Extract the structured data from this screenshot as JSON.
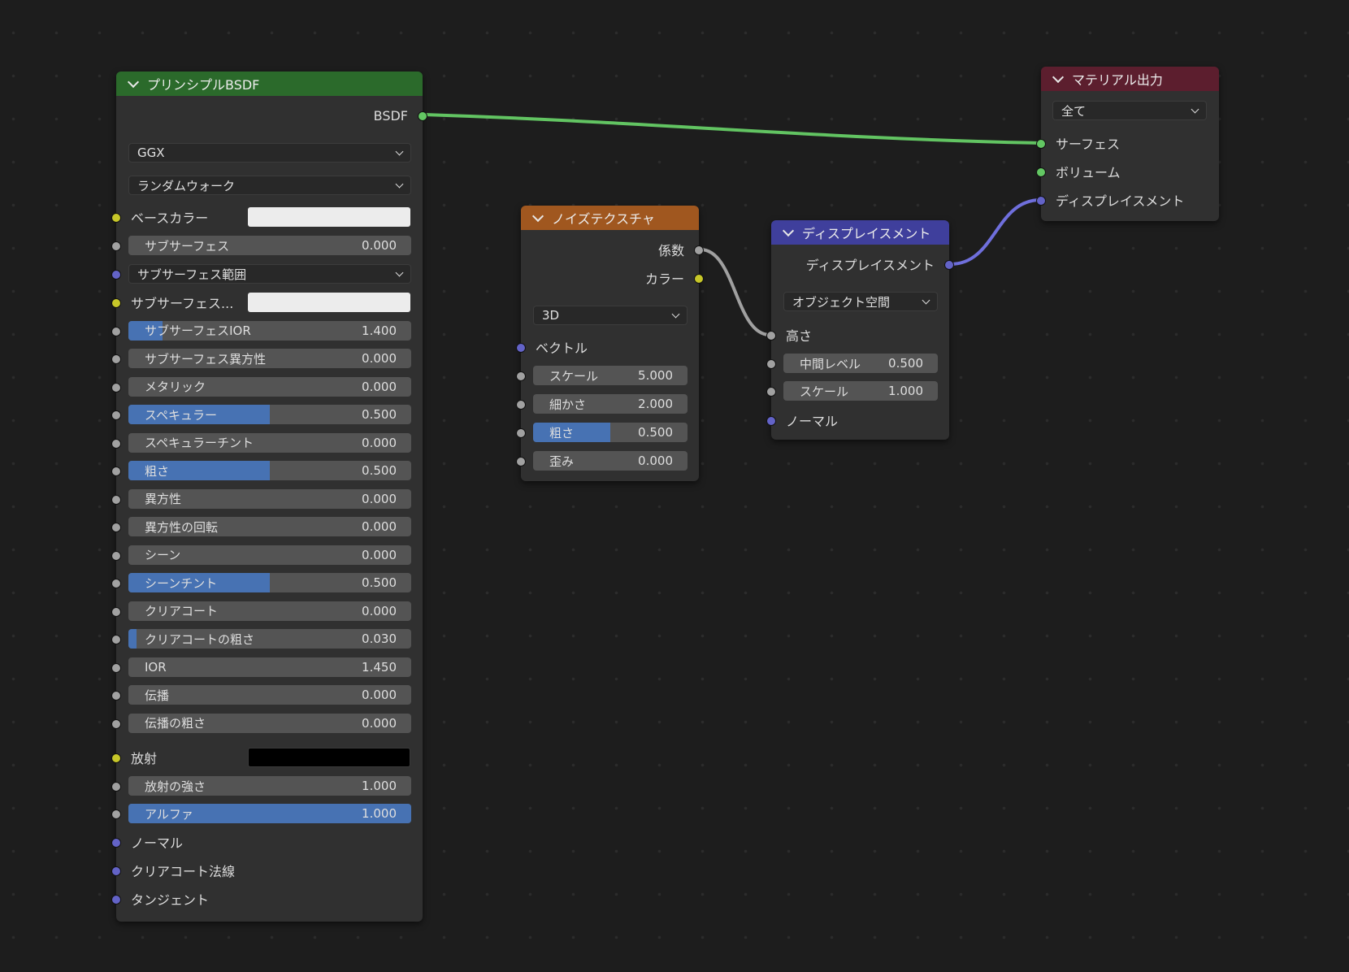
{
  "colors": {
    "link_bsdf": "#62c462",
    "link_gray": "#a0a0a0",
    "link_vector": "#6f6fdc",
    "header_shader": "#2b6a2b",
    "header_texture": "#a0571f",
    "header_vector": "#3f3f9c",
    "header_output": "#5c1e2e"
  },
  "bsdf": {
    "title": "プリンシプルBSDF",
    "output": "BSDF",
    "distribution": "GGX",
    "subsurface_method": "ランダムウォーク",
    "base_color_label": "ベースカラー",
    "subsurface_radius": "サブサーフェス範囲",
    "subsurface_color_label": "サブサーフェス...",
    "emission_label": "放射",
    "params": [
      {
        "label": "サブサーフェス",
        "value": "0.000",
        "fill": 0
      },
      {
        "label": "サブサーフェスIOR",
        "value": "1.400",
        "fill": 0.12
      },
      {
        "label": "サブサーフェス異方性",
        "value": "0.000",
        "fill": 0
      },
      {
        "label": "メタリック",
        "value": "0.000",
        "fill": 0
      },
      {
        "label": "スペキュラー",
        "value": "0.500",
        "fill": 0.5
      },
      {
        "label": "スペキュラーチント",
        "value": "0.000",
        "fill": 0
      },
      {
        "label": "粗さ",
        "value": "0.500",
        "fill": 0.5
      },
      {
        "label": "異方性",
        "value": "0.000",
        "fill": 0
      },
      {
        "label": "異方性の回転",
        "value": "0.000",
        "fill": 0
      },
      {
        "label": "シーン",
        "value": "0.000",
        "fill": 0
      },
      {
        "label": "シーンチント",
        "value": "0.500",
        "fill": 0.5
      },
      {
        "label": "クリアコート",
        "value": "0.000",
        "fill": 0
      },
      {
        "label": "クリアコートの粗さ",
        "value": "0.030",
        "fill": 0.03
      },
      {
        "label": "IOR",
        "value": "1.450",
        "fill": 0
      },
      {
        "label": "伝播",
        "value": "0.000",
        "fill": 0
      },
      {
        "label": "伝播の粗さ",
        "value": "0.000",
        "fill": 0
      }
    ],
    "emission_strength": {
      "label": "放射の強さ",
      "value": "1.000",
      "fill": 0
    },
    "alpha": {
      "label": "アルファ",
      "value": "1.000",
      "fill": 1
    },
    "vector_inputs": [
      "ノーマル",
      "クリアコート法線",
      "タンジェント"
    ]
  },
  "noise": {
    "title": "ノイズテクスチャ",
    "outputs": [
      "係数",
      "カラー"
    ],
    "dimensions": "3D",
    "vector_label": "ベクトル",
    "params": [
      {
        "label": "スケール",
        "value": "5.000",
        "fill": 0
      },
      {
        "label": "細かさ",
        "value": "2.000",
        "fill": 0
      },
      {
        "label": "粗さ",
        "value": "0.500",
        "fill": 0.5
      },
      {
        "label": "歪み",
        "value": "0.000",
        "fill": 0
      }
    ]
  },
  "displacement": {
    "title": "ディスプレイスメント",
    "output": "ディスプレイスメント",
    "space": "オブジェクト空間",
    "height_label": "高さ",
    "params": [
      {
        "label": "中間レベル",
        "value": "0.500",
        "fill": 0
      },
      {
        "label": "スケール",
        "value": "1.000",
        "fill": 0
      }
    ],
    "normal_label": "ノーマル"
  },
  "output": {
    "title": "マテリアル出力",
    "target": "全て",
    "inputs": [
      "サーフェス",
      "ボリューム",
      "ディスプレイスメント"
    ]
  }
}
